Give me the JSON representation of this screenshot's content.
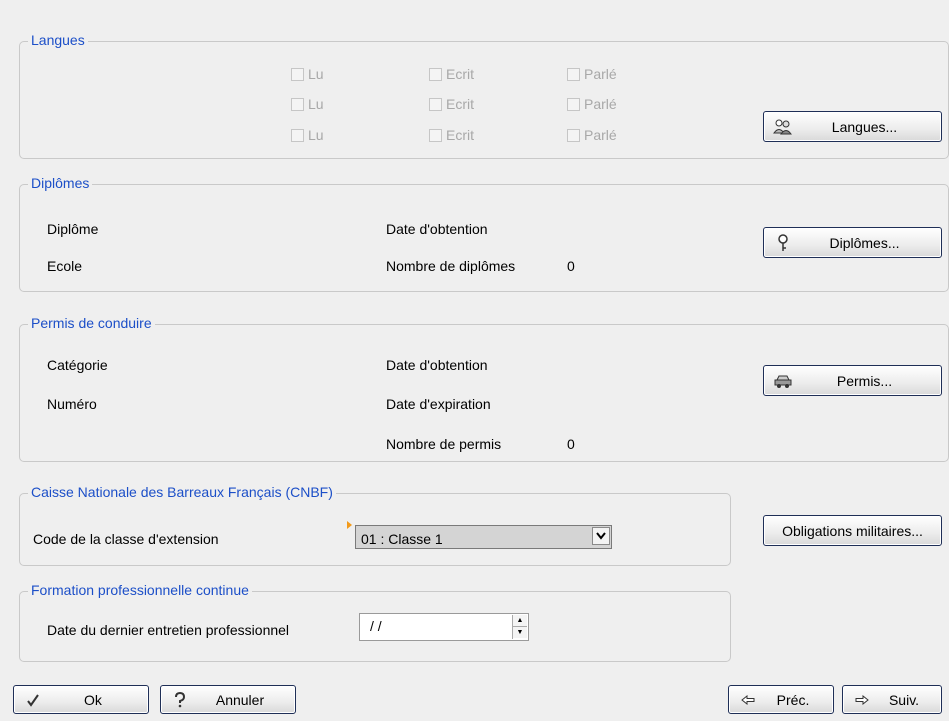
{
  "langues": {
    "title": "Langues",
    "rows": [
      {
        "lu": "Lu",
        "ecrit": "Ecrit",
        "parle": "Parlé"
      },
      {
        "lu": "Lu",
        "ecrit": "Ecrit",
        "parle": "Parlé"
      },
      {
        "lu": "Lu",
        "ecrit": "Ecrit",
        "parle": "Parlé"
      }
    ],
    "button": "Langues..."
  },
  "diplomes": {
    "title": "Diplômes",
    "diplome_label": "Diplôme",
    "ecole_label": "Ecole",
    "date_label": "Date d'obtention",
    "count_label": "Nombre de diplômes",
    "count_value": "0",
    "button": "Diplômes..."
  },
  "permis": {
    "title": "Permis de conduire",
    "categorie_label": "Catégorie",
    "numero_label": "Numéro",
    "date_obtention_label": "Date d'obtention",
    "date_expiration_label": "Date d'expiration",
    "count_label": "Nombre de permis",
    "count_value": "0",
    "button": "Permis..."
  },
  "cnbf": {
    "title": "Caisse Nationale des Barreaux Français (CNBF)",
    "code_label": "Code de la classe d'extension",
    "code_value": "01 : Classe 1"
  },
  "obligations_button": "Obligations militaires...",
  "formation": {
    "title": "Formation professionnelle continue",
    "date_label": "Date du dernier entretien professionnel",
    "date_value": "/ /"
  },
  "footer": {
    "ok": "Ok",
    "annuler": "Annuler",
    "prec": "Préc.",
    "suiv": "Suiv."
  }
}
